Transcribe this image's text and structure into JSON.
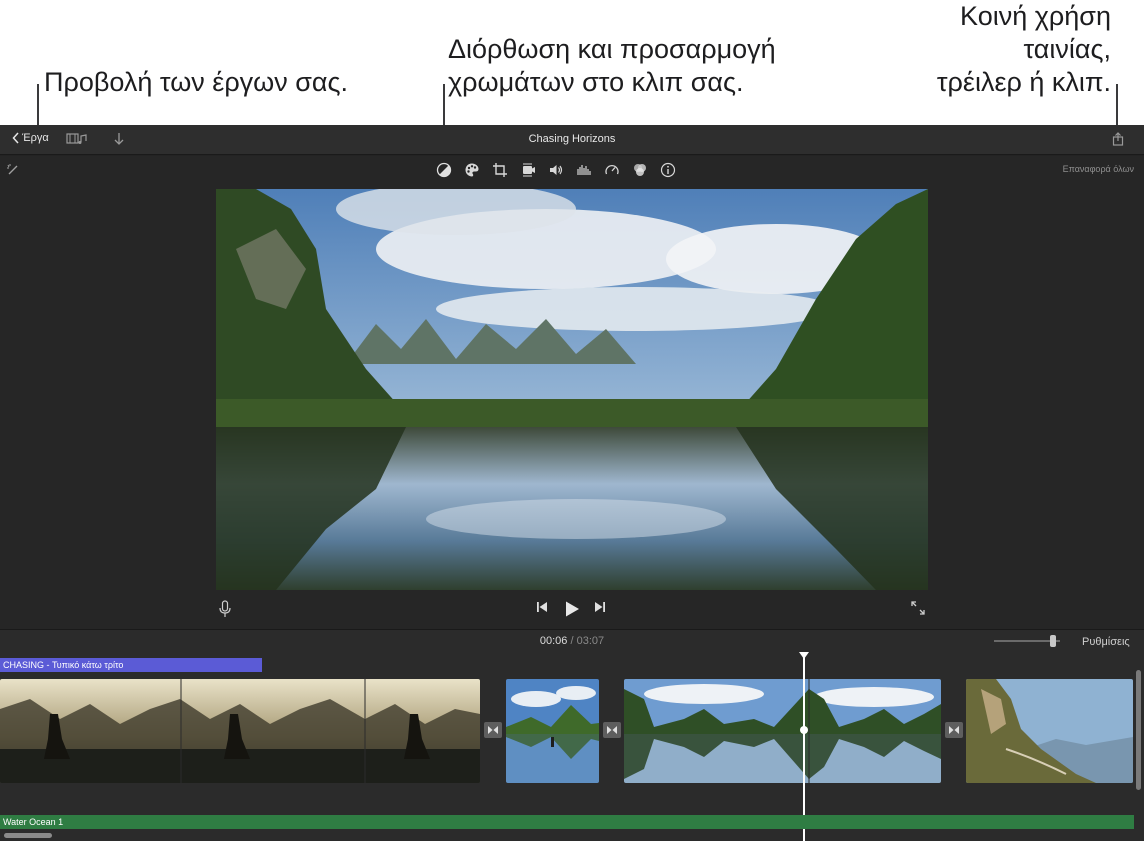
{
  "callouts": {
    "projects": "Προβολή των έργων σας.",
    "color_line1": "Διόρθωση και προσαρμογή",
    "color_line2": "χρωμάτων στο κλιπ σας.",
    "share_line1": "Κοινή χρήση",
    "share_line2": "ταινίας,",
    "share_line3": "τρέιλερ ή κλιπ."
  },
  "titlebar": {
    "back_label": "Έργα",
    "title": "Chasing Horizons",
    "icons": [
      "chevron-left-icon",
      "media-browser-icon",
      "download-icon",
      "share-icon"
    ]
  },
  "viewer": {
    "reset_all": "Επαναφορά όλων",
    "tools": [
      "magic-wand-icon",
      "color-balance-icon",
      "color-palette-icon",
      "crop-icon",
      "stabilization-icon",
      "volume-icon",
      "noise-reduction-icon",
      "speed-icon",
      "clip-filter-icon",
      "info-icon"
    ],
    "controls": [
      "microphone-icon",
      "skip-back-icon",
      "play-icon",
      "skip-forward-icon",
      "fullscreen-icon"
    ]
  },
  "timeline": {
    "current_time": "00:06",
    "separator": "/",
    "duration": "03:07",
    "settings_label": "Ρυθμίσεις",
    "title_clip_label": "CHASING - Τυπικό κάτω τρίτο",
    "audio_clip_label": "Water Ocean 1"
  },
  "colors": {
    "title_clip": "#5b5bd6",
    "audio_clip": "#2f7d43",
    "background": "#2b2b2b"
  }
}
